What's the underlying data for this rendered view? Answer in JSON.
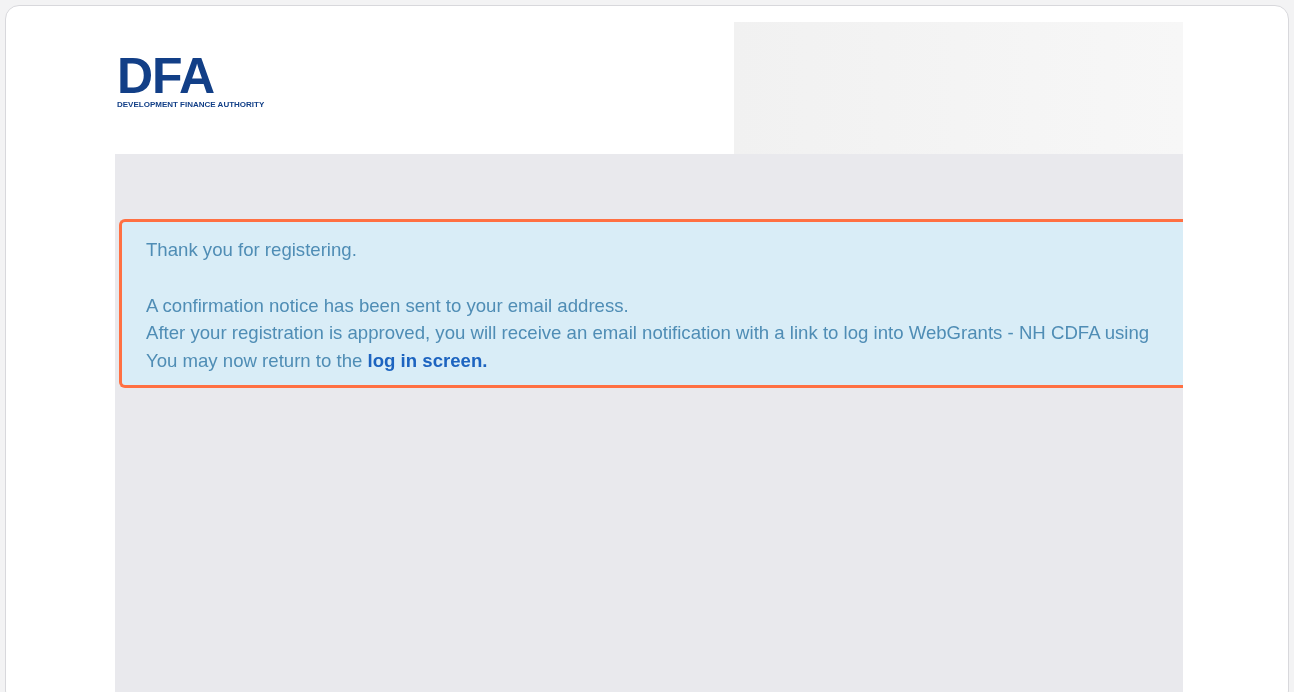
{
  "logo": {
    "mark": "DFA",
    "tagline": "DEVELOPMENT FINANCE AUTHORITY"
  },
  "alert": {
    "title": "Thank you for registering.",
    "lines": [
      "A confirmation notice has been sent to your email address.",
      "After your registration is approved, you will receive an email notification with a link to log into WebGrants - NH CDFA using"
    ],
    "return_line": {
      "text": "You may now return to the",
      "link": "log in screen."
    }
  }
}
